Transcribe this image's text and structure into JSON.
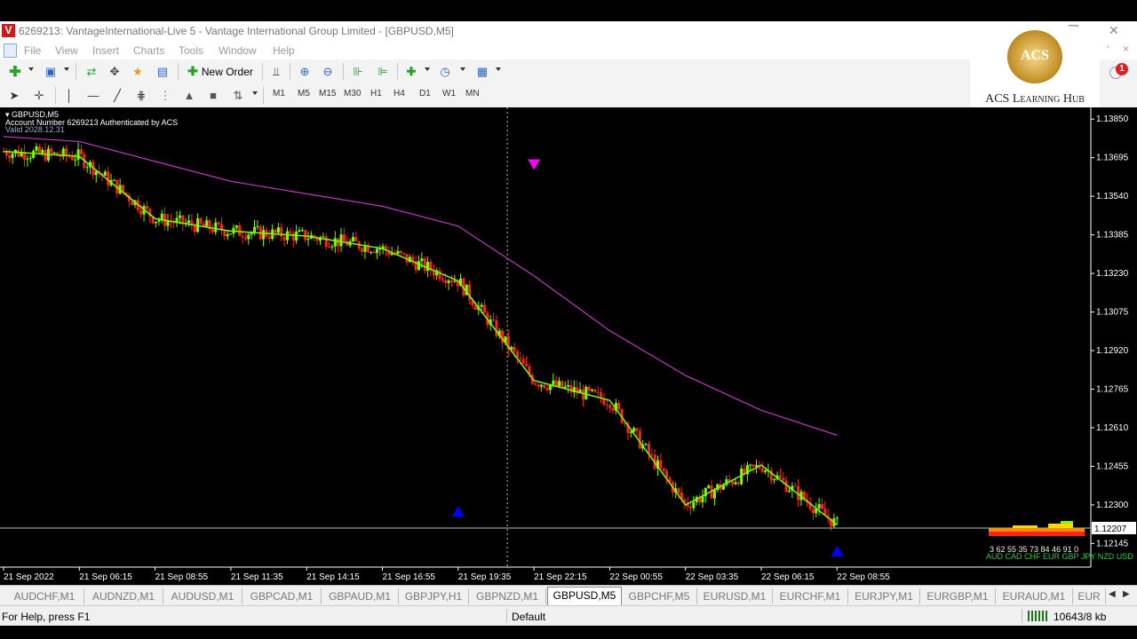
{
  "window": {
    "title": "6269213: VantageInternational-Live 5 - Vantage International Group Limited - [GBPUSD,M5]",
    "logo_letter": "V"
  },
  "menu": [
    "File",
    "View",
    "Insert",
    "Charts",
    "Tools",
    "Window",
    "Help"
  ],
  "toolbar": {
    "new_order_label": "New Order",
    "timeframes": [
      "M1",
      "M5",
      "M15",
      "M30",
      "H1",
      "H4",
      "D1",
      "W1",
      "MN"
    ]
  },
  "watermark": {
    "logo_text": "ACS",
    "brand": "ACS Learning Hub",
    "notification_count": "1"
  },
  "chart_header": {
    "symbol": "GBPUSD,M5",
    "account_line": "Account Number 6269213 Authenticated by ACS",
    "valid_line": "Valid 2028.12.31"
  },
  "chart_data": {
    "type": "line",
    "symbol": "GBPUSD",
    "timeframe": "M5",
    "current_price": "1.12207",
    "y_ticks": [
      "1.13850",
      "1.13695",
      "1.13540",
      "1.13385",
      "1.13230",
      "1.13075",
      "1.12920",
      "1.12765",
      "1.12610",
      "1.12455",
      "1.12300",
      "1.12145"
    ],
    "ylim": [
      1.1205,
      1.1389
    ],
    "x_ticks": [
      "21 Sep 2022",
      "21 Sep 06:15",
      "21 Sep 08:55",
      "21 Sep 11:35",
      "21 Sep 14:15",
      "21 Sep 16:55",
      "21 Sep 19:35",
      "21 Sep 22:15",
      "22 Sep 00:55",
      "22 Sep 03:35",
      "22 Sep 06:15",
      "22 Sep 08:55"
    ],
    "series": [
      {
        "color": "#7CFC00",
        "x": [
          "21 Sep 2022",
          "21 Sep 06:15",
          "21 Sep 08:55",
          "21 Sep 11:35",
          "21 Sep 14:15",
          "21 Sep 16:55",
          "21 Sep 19:35",
          "21 Sep 22:15",
          "22 Sep 00:55",
          "22 Sep 03:35",
          "22 Sep 06:15",
          "22 Sep 08:55"
        ],
        "y": [
          1.1372,
          1.137,
          1.1345,
          1.134,
          1.1338,
          1.1333,
          1.132,
          1.128,
          1.1272,
          1.123,
          1.1246,
          1.1222
        ]
      },
      {
        "color": "#c038c0",
        "x": [
          "21 Sep 2022",
          "21 Sep 06:15",
          "21 Sep 08:55",
          "21 Sep 11:35",
          "21 Sep 14:15",
          "21 Sep 16:55",
          "21 Sep 19:35",
          "21 Sep 22:15",
          "22 Sep 00:55",
          "22 Sep 03:35",
          "22 Sep 06:15",
          "22 Sep 08:55"
        ],
        "y": [
          1.1378,
          1.1376,
          1.1368,
          1.136,
          1.1355,
          1.135,
          1.1342,
          1.1322,
          1.13,
          1.1282,
          1.1268,
          1.1258
        ]
      }
    ],
    "signals": [
      {
        "type": "sell",
        "color": "#ff00ff",
        "x": "21 Sep 22:15",
        "y": 1.1366
      },
      {
        "type": "buy",
        "color": "#0000ff",
        "x": "21 Sep 19:35",
        "y": 1.1226
      },
      {
        "type": "buy",
        "color": "#0000ff",
        "x": "22 Sep 08:55",
        "y": 1.121
      }
    ],
    "indicator_text": "3 62 55 35 73 84 46 91 0",
    "indicator_text2": "AUD CAD CHF EUR GBP JPY NZD USD",
    "grid": false
  },
  "symbol_tabs": [
    "AUDCHF,M1",
    "AUDNZD,M1",
    "AUDUSD,M1",
    "GBPCAD,M1",
    "GBPAUD,M1",
    "GBPJPY,H1",
    "GBPNZD,M1",
    "GBPUSD,M5",
    "GBPCHF,M5",
    "EURUSD,M1",
    "EURCHF,M1",
    "EURJPY,M1",
    "EURGBP,M1",
    "EURAUD,M1",
    "EUR"
  ],
  "active_tab": "GBPUSD,M5",
  "status": {
    "help": "For Help, press F1",
    "profile": "Default",
    "traffic": "10643/8 kb"
  }
}
